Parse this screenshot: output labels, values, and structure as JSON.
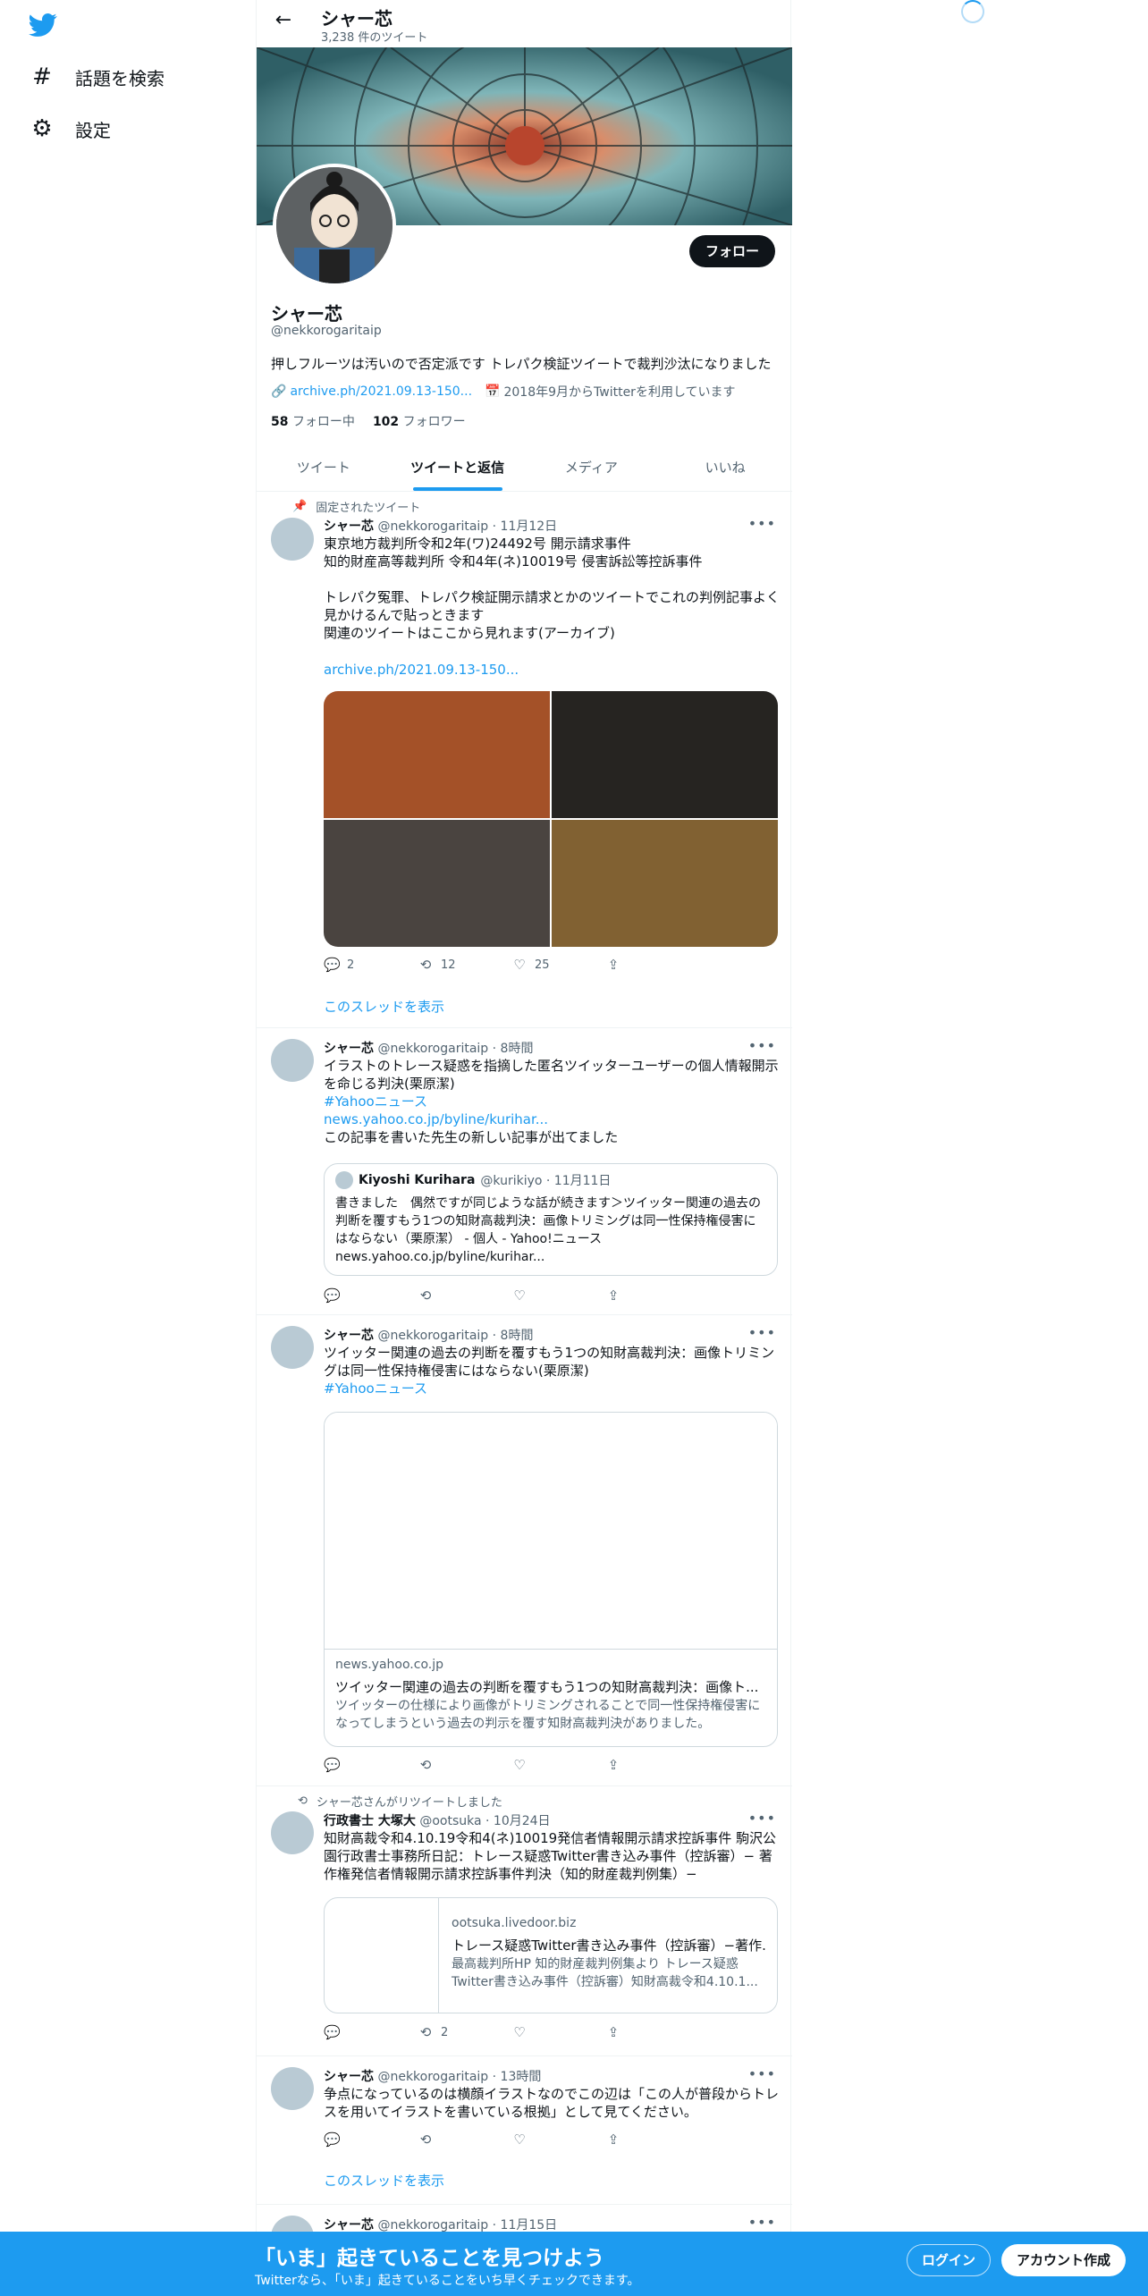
{
  "nav": {
    "explore": "話題を検索",
    "settings": "設定"
  },
  "header": {
    "title": "シャー芯",
    "tweet_count": "3,238 件のツイート"
  },
  "profile": {
    "name": "シャー芯",
    "handle": "@nekkorogaritaip",
    "follow_label": "フォロー",
    "bio": "押しフルーツは汚いので否定派です トレパク検証ツイートで裁判沙汰になりました",
    "link": "archive.ph/2021.09.13-150...",
    "joined": "2018年9月からTwitterを利用しています",
    "following_count": "58",
    "following_label": "フォロー中",
    "followers_count": "102",
    "followers_label": "フォロワー"
  },
  "tabs": [
    "ツイート",
    "ツイートと返信",
    "メディア",
    "いいね"
  ],
  "active_tab": 1,
  "tweets": [
    {
      "context": "固定されたツイート",
      "name": "シャー芯",
      "meta": "@nekkorogaritaip · 11月12日",
      "text": "東京地方裁判所令和2年(ワ)24492号 開示請求事件\n知的財産高等裁判所 令和4年(ネ)10019号 侵害訴訟等控訴事件\n\nトレパク冤罪、トレパク検証開示請求とかのツイートでこれの判例記事よく見かけるんで貼っときます\n関連のツイートはここから見れます(アーカイブ)",
      "link": "archive.ph/2021.09.13-150...",
      "images": [
        "#a45128",
        "#262421",
        "#4a4440",
        "#816132"
      ],
      "reply": "2",
      "retweet": "12",
      "like": "25",
      "thread": "このスレッドを表示"
    },
    {
      "name": "シャー芯",
      "meta": "@nekkorogaritaip · 8時間",
      "text": "イラストのトレース疑惑を指摘した匿名ツイッターユーザーの個人情報開示を命じる判決(栗原潔)",
      "hashtag": "#Yahooニュース",
      "link": "news.yahoo.co.jp/byline/kurihar...",
      "text2": "この記事を書いた先生の新しい記事が出てました",
      "quote": {
        "name": "Kiyoshi Kurihara",
        "meta": "@kurikiyo · 11月11日",
        "text": "書きました　偶然ですが同じような話が続きます＞ツイッター関連の過去の判断を覆すもう1つの知財高裁判決：画像トリミングは同一性保持権侵害にはならない（栗原潔） - 個人 - Yahoo!ニュース\nnews.yahoo.co.jp/byline/kurihar..."
      }
    },
    {
      "name": "シャー芯",
      "meta": "@nekkorogaritaip · 8時間",
      "text": "ツイッター関連の過去の判断を覆すもう1つの知財高裁判決：画像トリミングは同一性保持権侵害にはならない(栗原潔)",
      "hashtag": "#Yahooニュース",
      "card": {
        "domain": "news.yahoo.co.jp",
        "title": "ツイッター関連の過去の判断を覆すもう1つの知財高裁判決：画像ト...",
        "desc": "ツイッターの仕様により画像がトリミングされることで同一性保持権侵害になってしまうという過去の判示を覆す知財高裁判決がありました。"
      }
    },
    {
      "context": "シャー芯さんがリツイートしました",
      "name": "行政書士 大塚大",
      "meta": "@ootsuka · 10月24日",
      "text": "知財高裁令和4.10.19令和4(ネ)10019発信者情報開示請求控訴事件 駒沢公園行政書士事務所日記：トレース疑惑Twitter書き込み事件（控訴審）− 著作権発信者情報開示請求控訴事件判決（知的財産裁判例集）−",
      "card": {
        "domain": "ootsuka.livedoor.biz",
        "title": "トレース疑惑Twitter書き込み事件（控訴審）−著作...",
        "desc": "最高裁判所HP 知的財産裁判例集より トレース疑惑Twitter書き込み事件（控訴審）知財高裁令和4.10.1..."
      },
      "retweet": "2"
    },
    {
      "name": "シャー芯",
      "meta": "@nekkorogaritaip · 13時間",
      "text": "争点になっているのは横顔イラストなのでこの辺は「この人が普段からトレスを用いてイラストを書いている根拠」として見てください。",
      "thread": "このスレッドを表示"
    },
    {
      "name": "シャー芯",
      "meta": "@nekkorogaritaip · 11月15日"
    }
  ],
  "bottom_bar": {
    "title": "「いま」起きていることを見つけよう",
    "subtitle": "Twitterなら、「いま」起きていることをいち早くチェックできます。",
    "login": "ログイン",
    "signup": "アカウント作成"
  }
}
